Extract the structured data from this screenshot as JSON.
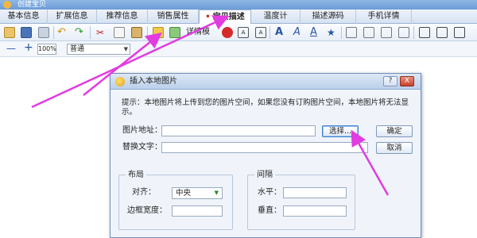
{
  "app": {
    "title": "创建宝贝"
  },
  "tabs": [
    {
      "label": "基本信息"
    },
    {
      "label": "扩展信息"
    },
    {
      "label": "推荐信息"
    },
    {
      "label": "销售属性"
    },
    {
      "label": "宝贝描述",
      "marker": "•"
    },
    {
      "label": "温度计"
    },
    {
      "label": "描述源码"
    },
    {
      "label": "手机详情"
    }
  ],
  "toolbar": {
    "detail_label": "详情模"
  },
  "toolbar2": {
    "minus": "—",
    "plus": "+",
    "zoom": "100%",
    "style": "普通",
    "dropdown_arrow": "▼"
  },
  "dialog": {
    "title": "插入本地图片",
    "help_button": "?",
    "close_button": "X",
    "hint": "提示：本地图片将上传到您的图片空间，如果您没有订购图片空间，本地图片将无法显示。",
    "image_address_label": "图片地址：",
    "image_address_value": "",
    "browse_button": "选择...",
    "ok_button": "确定",
    "alt_text_label": "替换文字：",
    "alt_text_value": "",
    "cancel_button": "取消",
    "layout": {
      "legend": "布局",
      "align_label": "对齐：",
      "align_value": "中央",
      "border_width_label": "边框宽度：",
      "border_width_value": ""
    },
    "spacing": {
      "legend": "间隔",
      "horizontal_label": "水平：",
      "horizontal_value": "",
      "vertical_label": "垂直：",
      "vertical_value": ""
    }
  },
  "colors": {
    "arrow": "#e23be0",
    "accent": "#6a9bd6",
    "dialog_bg": "#f0f4fa"
  }
}
